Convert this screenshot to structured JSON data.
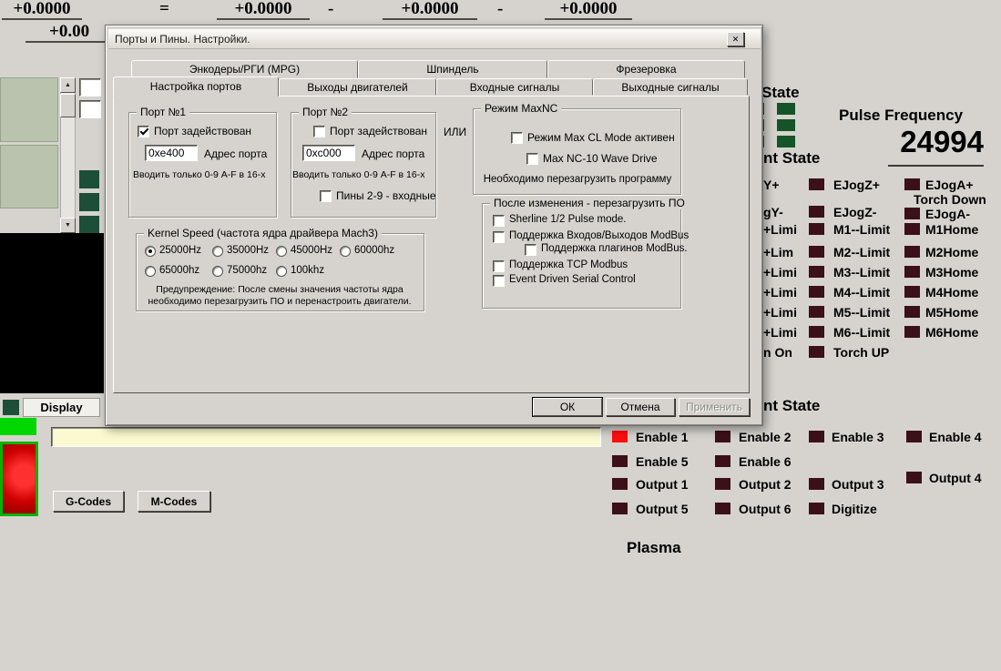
{
  "dro": {
    "v1": "+0.0000",
    "op1": "=",
    "v2": "+0.0000",
    "op2": "-",
    "v3": "+0.0000",
    "op3": "-",
    "v4": "+0.0000",
    "v5": "+0.00"
  },
  "left_panel": {
    "display_label": "Display",
    "gcodes_button": "G-Codes",
    "mcodes_button": "M-Codes"
  },
  "right_panel": {
    "state_top": "State",
    "pulse_frequency_label": "Pulse Frequency",
    "pulse_frequency_value": "24994",
    "current_state": "nt State",
    "current_state2": "nt State",
    "left_col": [
      "Y+",
      "gY-",
      "+Limi",
      "+Lim",
      "+Limi",
      "+Limi",
      "+Limi",
      "+Limi",
      "n On"
    ],
    "mid_col": [
      "EJogZ+",
      "EJogZ-",
      "M1--Limit",
      "M2--Limit",
      "M3--Limit",
      "M4--Limit",
      "M5--Limit",
      "M6--Limit",
      "Torch UP"
    ],
    "right_col": [
      "EJogA+",
      "Torch Down",
      "EJogA-",
      "M1Home",
      "M2Home",
      "M3Home",
      "M4Home",
      "M5Home",
      "M6Home"
    ],
    "enable_labels": [
      "Enable 1",
      "Enable 2",
      "Enable 3",
      "Enable 4",
      "Enable 5",
      "Enable 6"
    ],
    "output_labels": [
      "Output 1",
      "Output 2",
      "Output 3",
      "Output 4",
      "Output 5",
      "Output 6"
    ],
    "digitize_label": "Digitize",
    "plasma_label": "Plasma"
  },
  "dialog": {
    "title": "Порты и Пины.  Настройки.",
    "tabs_top": [
      "Энкодеры/РГИ (MPG)",
      "Шпиндель",
      "Фрезеровка"
    ],
    "tabs_bottom": [
      "Настройка портов",
      "Выходы двигателей",
      "Входные сигналы",
      "Выходные сигналы"
    ],
    "port1": {
      "legend": "Порт №1",
      "enable_label": "Порт задействован",
      "address_value": "0xe400",
      "address_label": "Адрес порта",
      "hint": "Вводить только 0-9 A-F в 16-х"
    },
    "port2": {
      "legend": "Порт №2",
      "enable_label": "Порт задействован",
      "address_value": "0xc000",
      "address_label": "Адрес порта",
      "hint": "Вводить только 0-9 A-F в 16-х",
      "pins_label": "Пины 2-9 - входные"
    },
    "or_label": "ИЛИ",
    "maxnc": {
      "legend": "Режим MaxNC",
      "option1": "Режим Max CL Mode активен",
      "option2": "Max NC-10 Wave Drive",
      "note": "Необходимо перезагрузить программу"
    },
    "restart": {
      "legend": "После изменения - перезагрузить ПО",
      "options": [
        "Sherline 1/2 Pulse mode.",
        "Поддержка Входов/Выходов ModBus",
        "Поддержка плагинов ModBus.",
        "Поддержка TCP Modbus",
        "Event Driven Serial Control"
      ]
    },
    "kernel": {
      "legend": "Kernel Speed (частота ядра драйвера Mach3)",
      "options": [
        "25000Hz",
        "35000Hz",
        "45000Hz",
        "60000hz",
        "65000hz",
        "75000hz",
        "100khz"
      ],
      "selected": "25000Hz",
      "warning_line1": "Предупреждение: После смены значения частоты ядра",
      "warning_line2": "необходимо перезагрузить ПО и перенастроить двигатели."
    },
    "buttons": {
      "ok": "ОК",
      "cancel": "Отмена",
      "apply": "Применить"
    }
  },
  "icons": {
    "close": "✕",
    "scroll_up": "▲",
    "scroll_down": "▼"
  },
  "colors": {
    "background": "#d6d3ce",
    "led_off": "#3c1019",
    "led_on_red": "#ff0e0e",
    "led_green": "#155428",
    "estop_red": "#cc0000",
    "enable_green": "#00d600",
    "field_yellow": "#fbf9cf"
  }
}
